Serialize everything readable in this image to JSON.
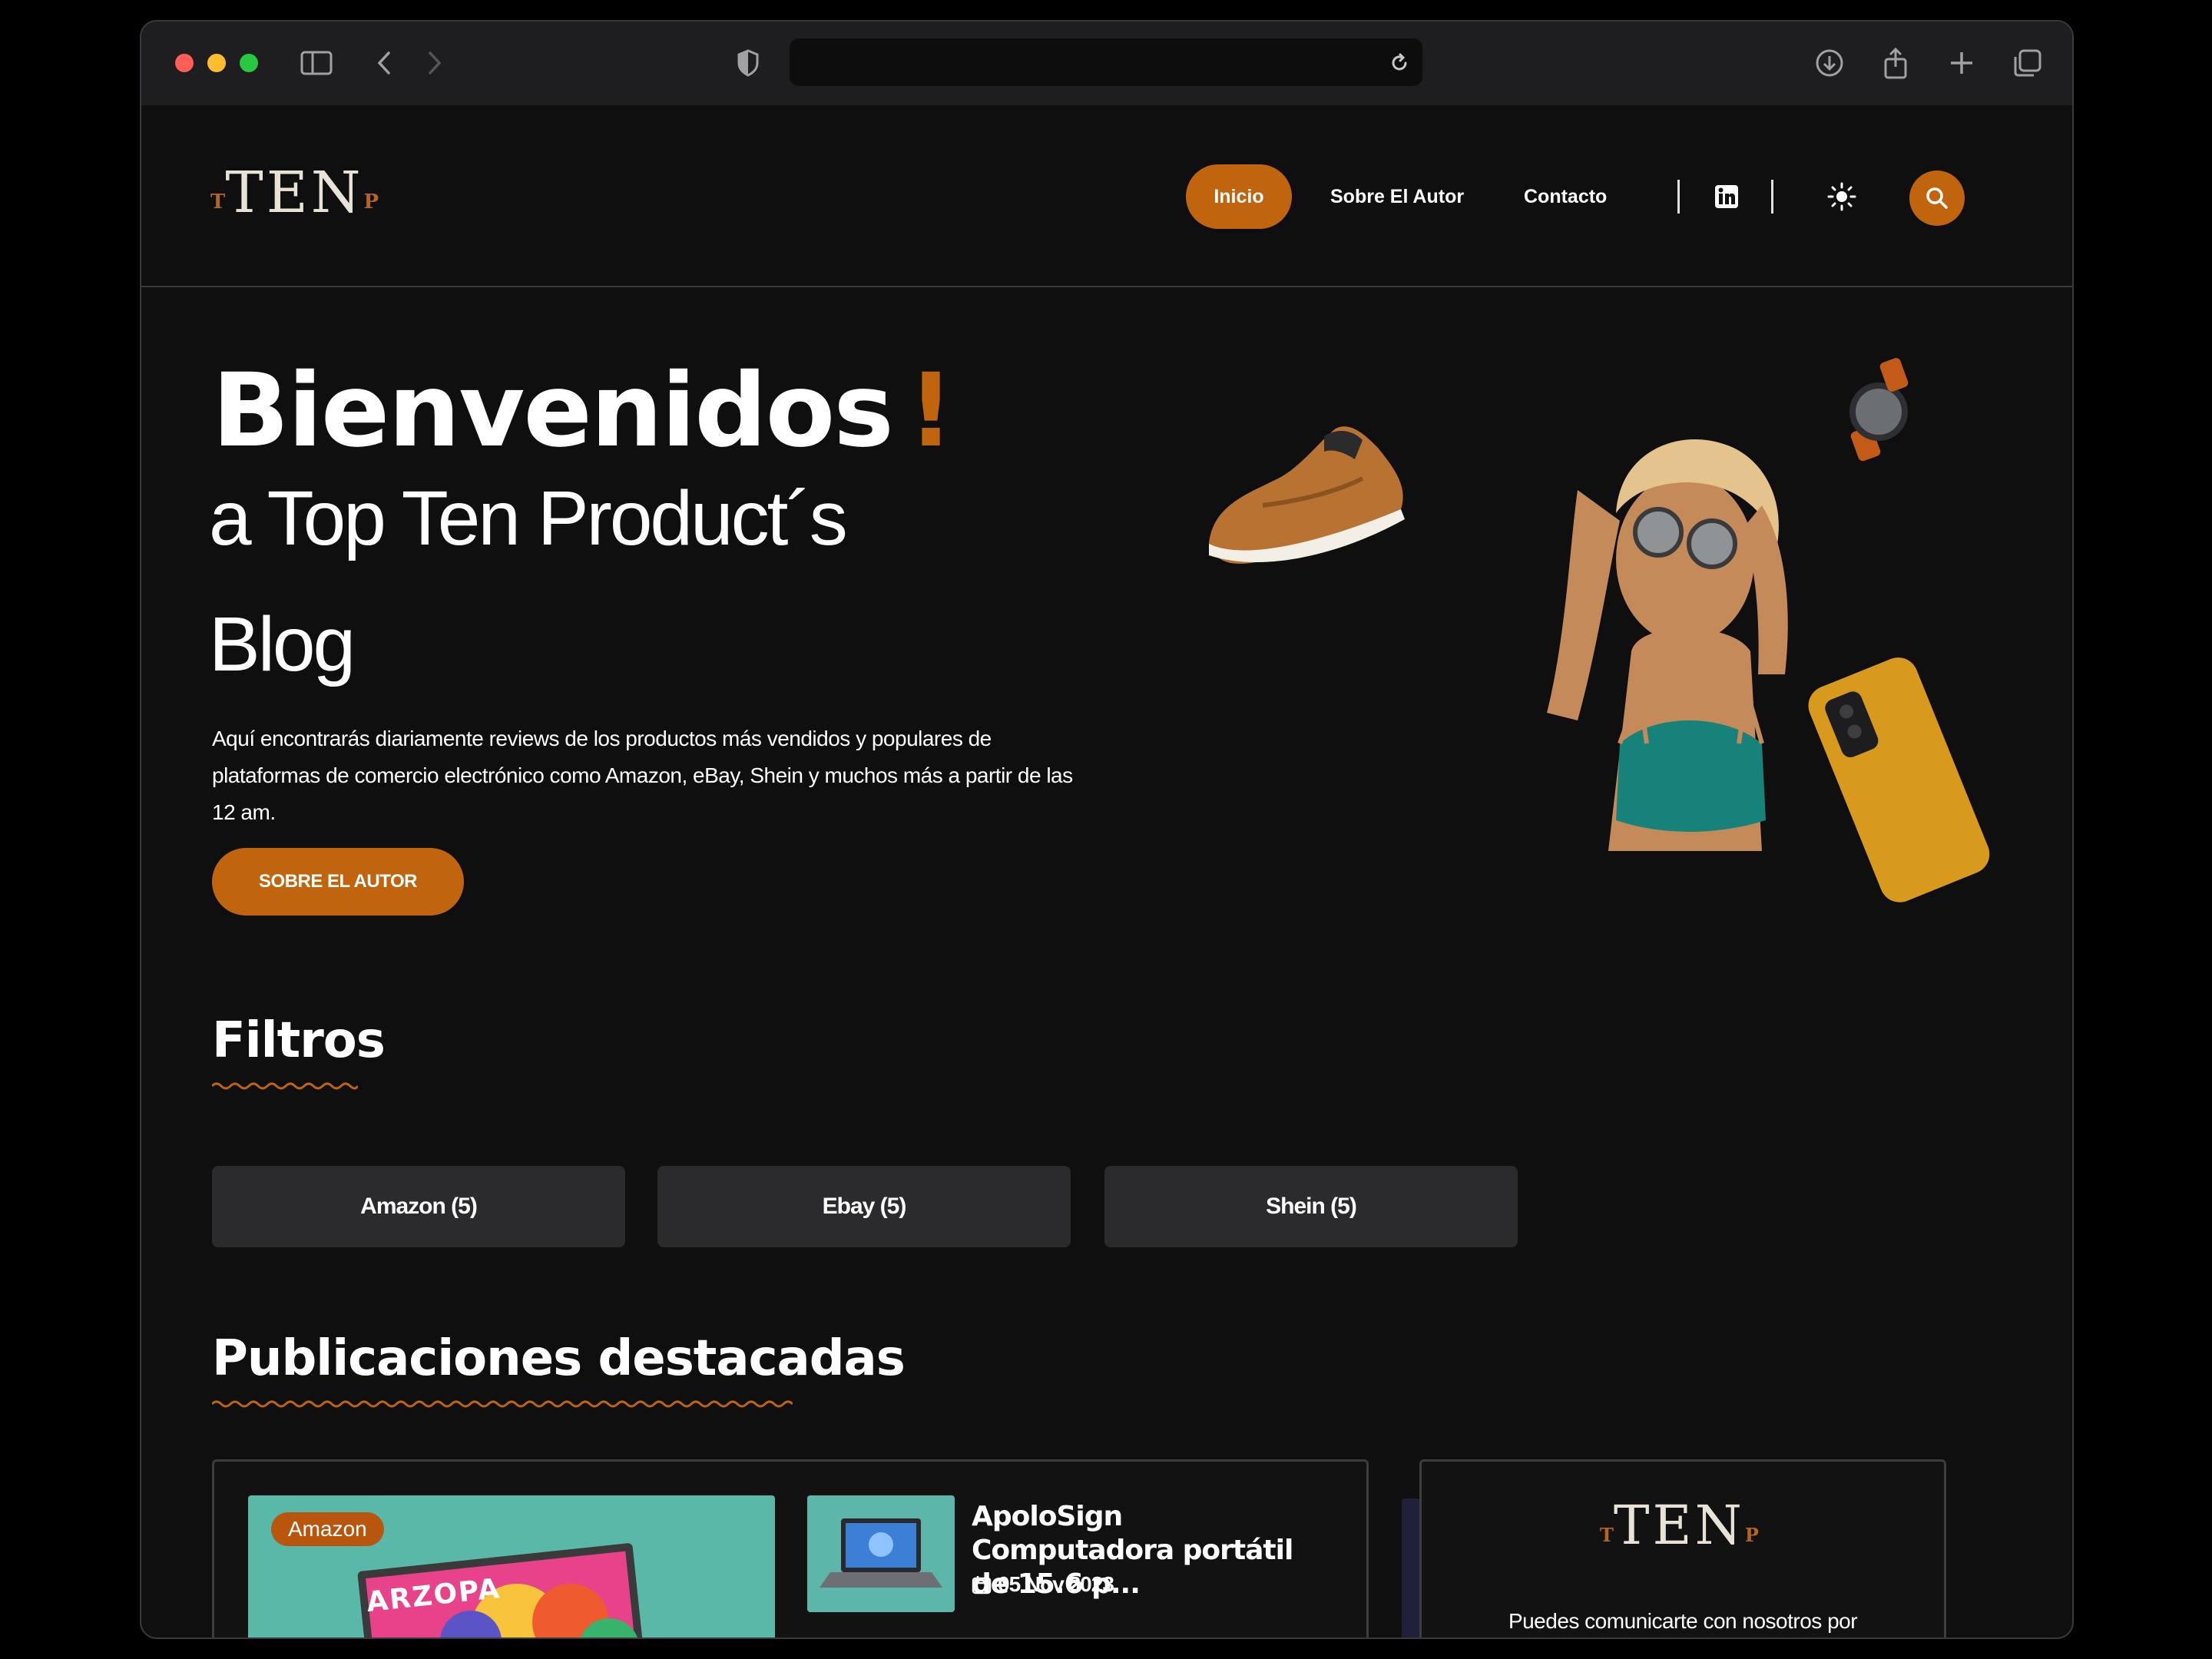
{
  "browser": {
    "url": ""
  },
  "header": {
    "logo": {
      "left": "T",
      "main": "TEN",
      "right": "P"
    },
    "nav": {
      "home": "Inicio",
      "about": "Sobre El Autor",
      "contact": "Contacto"
    }
  },
  "hero": {
    "title": "Bienvenidos",
    "title_mark": "!",
    "subtitle_line1": "a Top Ten Product´s",
    "subtitle_line2": "Blog",
    "description": "Aquí encontrarás diariamente reviews de los productos más vendidos y populares de plataformas de comercio electrónico como Amazon, eBay, Shein y muchos más a partir de las 12 am.",
    "button": "SOBRE EL AUTOR"
  },
  "filters": {
    "title": "Filtros",
    "items": [
      "Amazon (5)",
      "Ebay (5)",
      "Shein (5)"
    ]
  },
  "featured": {
    "title": "Publicaciones destacadas",
    "main_card": {
      "badge": "Amazon",
      "image_text": "ARZOPA"
    },
    "side_post": {
      "title": "ApoloSign Computadora portátil de 15.6 p...",
      "date": "05 Nov 2023"
    }
  },
  "contact_card": {
    "logo": {
      "left": "T",
      "main": "TEN",
      "right": "P"
    },
    "text": "Puedes comunicarte con nosotros por"
  },
  "colors": {
    "accent": "#c0650e",
    "background": "#0f0f10",
    "filter_bg": "#2b2b2e"
  }
}
